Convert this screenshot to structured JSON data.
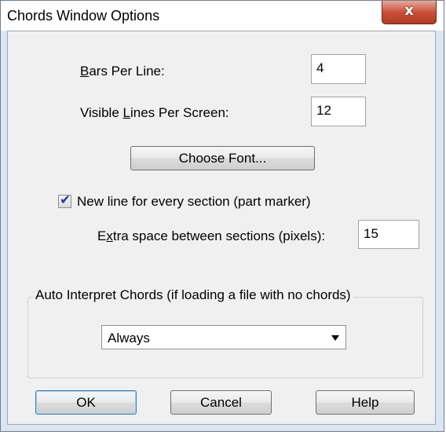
{
  "dialog": {
    "title": "Chords Window Options",
    "close_glyph": "x"
  },
  "bars_per_line": {
    "label_underlined": "B",
    "label_rest": "ars Per Line:",
    "value": "4"
  },
  "visible_lines": {
    "label_before": "Visible ",
    "label_underlined": "L",
    "label_rest": "ines Per Screen:",
    "value": "12"
  },
  "choose_font_button": "Choose Font...",
  "new_line_option": {
    "label": "New line for every section (part marker)",
    "checked": true
  },
  "extra_space": {
    "label_before": "E",
    "label_underlined": "x",
    "label_rest": "tra space between sections (pixels):",
    "value": "15"
  },
  "auto_interpret": {
    "legend": "Auto Interpret Chords (if loading a file with no chords)",
    "selected": "Always"
  },
  "buttons": {
    "ok": "OK",
    "cancel": "Cancel",
    "help": "Help"
  }
}
